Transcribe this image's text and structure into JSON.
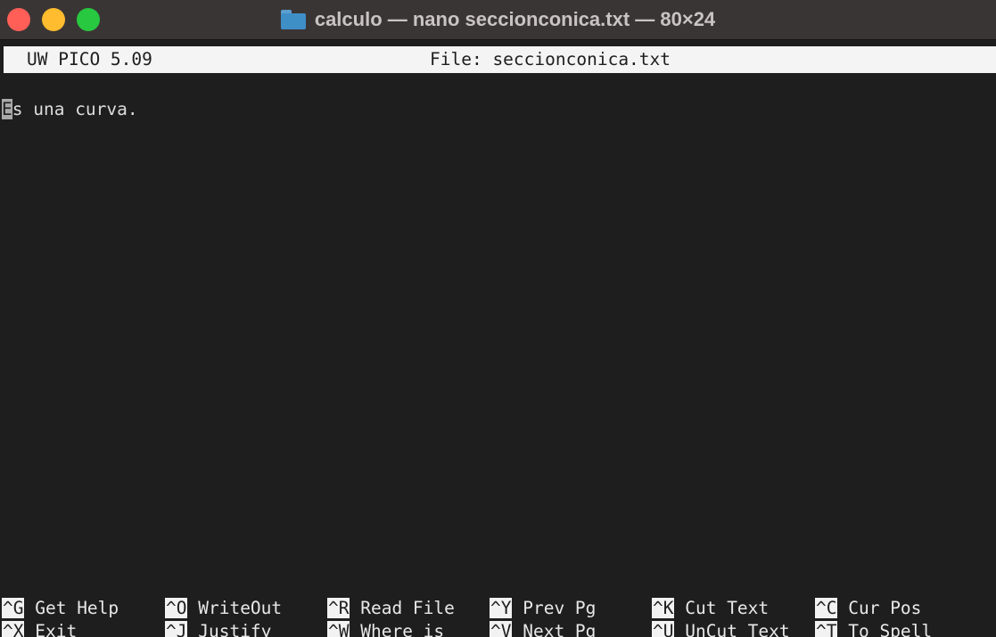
{
  "window": {
    "title": "calculo — nano seccionconica.txt — 80×24"
  },
  "editor": {
    "version": "UW PICO 5.09",
    "file_label": "File: seccionconica.txt",
    "content": {
      "cursor_char": "E",
      "rest": "s una curva."
    }
  },
  "shortcuts": {
    "row1": [
      {
        "key": "^G",
        "label": "Get Help"
      },
      {
        "key": "^O",
        "label": "WriteOut"
      },
      {
        "key": "^R",
        "label": "Read File"
      },
      {
        "key": "^Y",
        "label": "Prev Pg"
      },
      {
        "key": "^K",
        "label": "Cut Text"
      },
      {
        "key": "^C",
        "label": "Cur Pos"
      }
    ],
    "row2": [
      {
        "key": "^X",
        "label": "Exit"
      },
      {
        "key": "^J",
        "label": "Justify"
      },
      {
        "key": "^W",
        "label": "Where is"
      },
      {
        "key": "^V",
        "label": "Next Pg"
      },
      {
        "key": "^U",
        "label": "UnCut Text"
      },
      {
        "key": "^T",
        "label": "To Spell"
      }
    ]
  },
  "colors": {
    "close": "#ff5f57",
    "minimize": "#febc2e",
    "zoom": "#28c840",
    "terminal_bg": "#1e1e1e"
  },
  "icons": {
    "title_icon": "folder-icon"
  }
}
